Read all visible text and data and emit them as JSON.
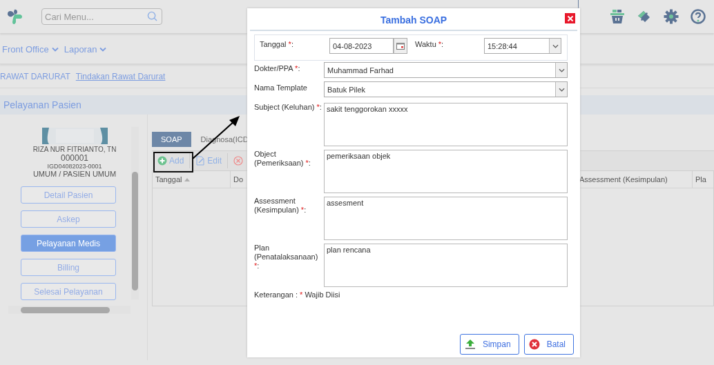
{
  "header": {
    "search": {
      "placeholder": "Cari Menu..."
    }
  },
  "nav": {
    "menus": [
      {
        "label": "Front Office"
      },
      {
        "label": "Laporan"
      }
    ]
  },
  "breadcrumb": [
    {
      "kind": "text",
      "label": "RAWAT DARURAT"
    },
    {
      "kind": "link",
      "label": "Tindakan Rawat Darurat"
    }
  ],
  "section_title": "Pelayanan Pasien",
  "patient": {
    "name": "RIZA NUR FITRIANTO, TN",
    "number": "000001",
    "visit": "IGD04082023-0001",
    "payer": "UMUM / PASIEN UMUM"
  },
  "side_buttons": [
    {
      "label": "Detail Pasien",
      "selected": false
    },
    {
      "label": "Askep",
      "selected": false
    },
    {
      "label": "Pelayanan Medis",
      "selected": true
    },
    {
      "label": "Billing",
      "selected": false
    },
    {
      "label": "Selesai Pelayanan",
      "selected": false
    }
  ],
  "tabs": [
    {
      "label": "SOAP",
      "selected": true
    },
    {
      "label": "Diagnosa(ICD",
      "selected": false
    }
  ],
  "toolbar": [
    {
      "kind": "add",
      "label": "Add"
    },
    {
      "kind": "edit",
      "label": "Edit"
    },
    {
      "kind": "delete"
    }
  ],
  "grid": {
    "columns": [
      {
        "label": "Tanggal",
        "sorted": true
      },
      {
        "label": "Do"
      },
      {
        "label": "Assessment (Kesimpulan)"
      },
      {
        "label": "Pla"
      }
    ]
  },
  "modal": {
    "title": "Tambah SOAP",
    "date": {
      "label": "Tanggal ",
      "mark": "*",
      "after": ":",
      "value": "04-08-2023"
    },
    "time": {
      "label": "Waktu ",
      "mark": "*",
      "after": ":",
      "value": "15:28:44"
    },
    "fields": [
      {
        "kind": "select",
        "label": "Dokter/PPA ",
        "mark": "*",
        "after": ":",
        "value": "Muhammad Farhad"
      },
      {
        "kind": "select",
        "label": "Nama Template",
        "value": "Batuk Pilek"
      },
      {
        "kind": "textarea",
        "label": "Subject (Keluhan) ",
        "mark": "*",
        "after": ":",
        "value": "sakit tenggorokan xxxxx"
      },
      {
        "kind": "textarea",
        "label": "Object (Pemeriksaan) ",
        "mark": "*",
        "after": ":",
        "value": "pemeriksaan objek"
      },
      {
        "kind": "textarea",
        "label": "Assessment (Kesimpulan) ",
        "mark": "*",
        "after": ":",
        "value": "assesment"
      },
      {
        "kind": "textarea",
        "label": "Plan (Penatalaksanaan) ",
        "mark": "*",
        "after": ":",
        "value": "plan rencana"
      }
    ],
    "note": {
      "label": "Keterangan : ",
      "mark": "*",
      "text": " Wajib Diisi"
    },
    "buttons": [
      {
        "kind": "save",
        "label": "Simpan"
      },
      {
        "kind": "cancel",
        "label": "Batal"
      }
    ]
  }
}
